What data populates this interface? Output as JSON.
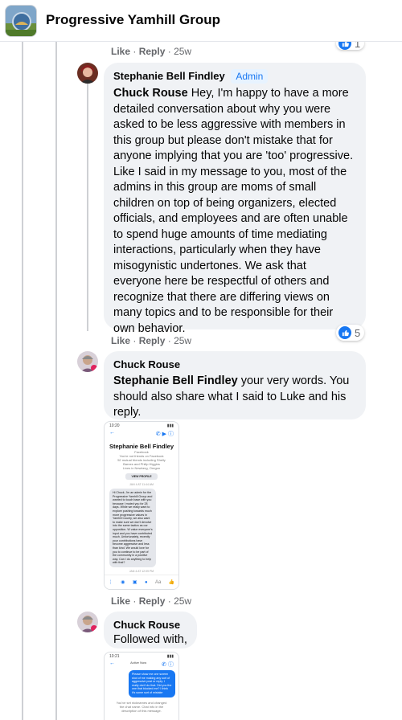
{
  "header": {
    "title": "Progressive Yamhill Group"
  },
  "actions": {
    "like": "Like",
    "reply": "Reply",
    "sep": "·"
  },
  "top_row": {
    "time": "25w",
    "reaction_count": "1"
  },
  "comments": [
    {
      "author": "Stephanie Bell Findley",
      "badge": "Admin",
      "mention": "Chuck Rouse",
      "text": " Hey, I'm happy to have a more detailed conversation about why you were asked to be less aggressive with members in this group but please don't mistake that for anyone implying that you are 'too' progressive. Like I said in my message to you, most of the admins in this group are moms of small children on top of being organizers, elected officials, and employees and are often unable to spend huge amounts of time mediating interactions, particularly when they have misogynistic undertones. We ask that everyone here be respectful of others and recognize that there are differing views on many topics and to be responsible for their own behavior.",
      "time": "25w",
      "reaction_count": "5"
    },
    {
      "author": "Chuck Rouse",
      "mention": "Stephanie Bell Findley",
      "text": " your very words. You should also share what I said to Luke and his reply.",
      "time": "25w"
    },
    {
      "author": "Chuck Rouse",
      "text": "Followed with,"
    }
  ],
  "screenshot1": {
    "status_time": "10:20",
    "name": "Stephanie Bell Findley",
    "platform": "Facebook",
    "friends_line": "You're not friends on Facebook",
    "mutual": "52 mutual friends including Shelly Barnes and Philip Higgins",
    "location": "Lives in Newberg, Oregon",
    "view_profile": "VIEW PROFILE",
    "date1": "JAN 4 AT 11:44 AM",
    "message": "Hi Chuck, I'm an admin for the Progressive Yamhill Group and wanted to touch base with you because I muted you for 28 days. While we really want to explore pushing towards much more progressive values in Yamhill County, we also want to make sure we don't devolve into the same tactics as our opposition. W value everyone's input and you have contributed much. Unfortunately, recently your contributions have become aggressive and less than kind. We would love for you to continue to be part of the community in a positive way. Can I do anything to help with that?",
    "date2": "JAN 4 AT 12:09 PM",
    "input_placeholder": "Aa"
  },
  "screenshot2": {
    "status_time": "10:21",
    "header": "Active Now",
    "message": "Please show me one screen shot of me making any sort of aggressive post or reply. I really don't do that. Did you the one that blocked me? I think it's some sort of mistake",
    "footer": "You've set nicknames and changed the chat name. Chat info in the description of this message."
  },
  "colors": {
    "link_blue": "#1877f2",
    "bubble_bg": "#f0f2f5",
    "meta_gray": "#65676b",
    "admin_badge_bg": "#e7f3ff",
    "thread_line": "#ced0d4"
  }
}
